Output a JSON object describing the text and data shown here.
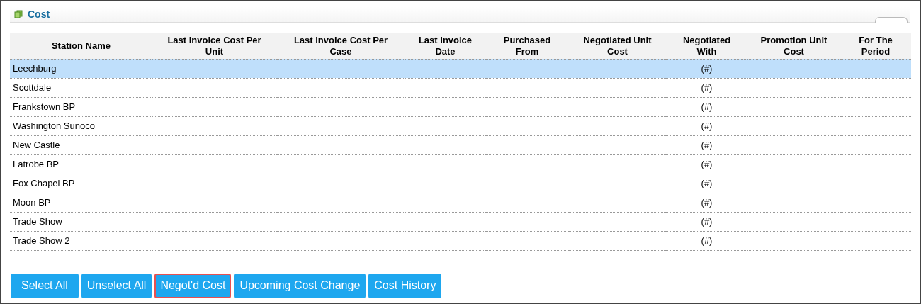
{
  "panel": {
    "title": "Cost"
  },
  "table": {
    "columns": [
      "Station Name",
      "Last Invoice Cost Per Unit",
      "Last Invoice Cost Per Case",
      "Last Invoice Date",
      "Purchased From",
      "Negotiated Unit Cost",
      "Negotiated With",
      "Promotion Unit Cost",
      "For The Period"
    ],
    "rows": [
      {
        "selected": true,
        "cells": [
          "Leechburg",
          "",
          "",
          "",
          "",
          "",
          "(#)",
          "",
          ""
        ]
      },
      {
        "selected": false,
        "cells": [
          "Scottdale",
          "",
          "",
          "",
          "",
          "",
          "(#)",
          "",
          ""
        ]
      },
      {
        "selected": false,
        "cells": [
          "Frankstown BP",
          "",
          "",
          "",
          "",
          "",
          "(#)",
          "",
          ""
        ]
      },
      {
        "selected": false,
        "cells": [
          "Washington Sunoco",
          "",
          "",
          "",
          "",
          "",
          "(#)",
          "",
          ""
        ]
      },
      {
        "selected": false,
        "cells": [
          "New Castle",
          "",
          "",
          "",
          "",
          "",
          "(#)",
          "",
          ""
        ]
      },
      {
        "selected": false,
        "cells": [
          "Latrobe BP",
          "",
          "",
          "",
          "",
          "",
          "(#)",
          "",
          ""
        ]
      },
      {
        "selected": false,
        "cells": [
          "Fox Chapel BP",
          "",
          "",
          "",
          "",
          "",
          "(#)",
          "",
          ""
        ]
      },
      {
        "selected": false,
        "cells": [
          "Moon BP",
          "",
          "",
          "",
          "",
          "",
          "(#)",
          "",
          ""
        ]
      },
      {
        "selected": false,
        "cells": [
          "Trade Show",
          "",
          "",
          "",
          "",
          "",
          "(#)",
          "",
          ""
        ]
      },
      {
        "selected": false,
        "cells": [
          "Trade Show 2",
          "",
          "",
          "",
          "",
          "",
          "(#)",
          "",
          ""
        ]
      }
    ]
  },
  "buttons": [
    {
      "label": "Select All",
      "highlighted": false
    },
    {
      "label": "Unselect All",
      "highlighted": false
    },
    {
      "label": "Negot'd Cost",
      "highlighted": true
    },
    {
      "label": "Upcoming Cost Change",
      "highlighted": false
    },
    {
      "label": "Cost History",
      "highlighted": false
    }
  ]
}
